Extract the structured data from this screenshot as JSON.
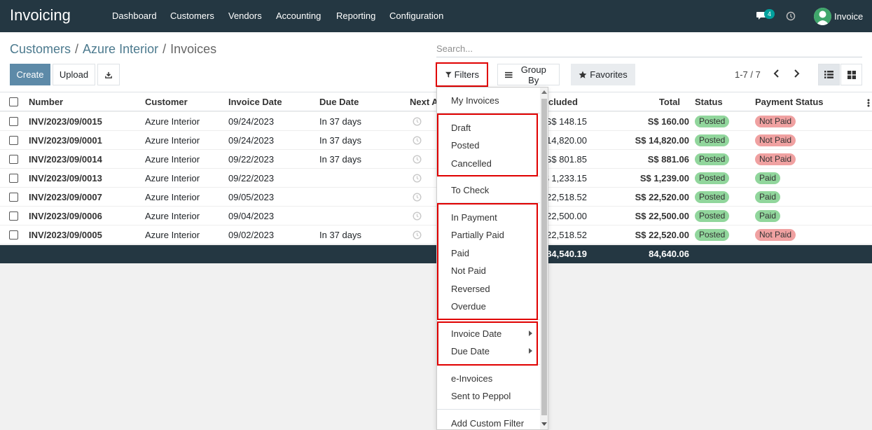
{
  "app": {
    "title": "Invoicing"
  },
  "menu": [
    "Dashboard",
    "Customers",
    "Vendors",
    "Accounting",
    "Reporting",
    "Configuration"
  ],
  "nav": {
    "chat_count": "4",
    "user": "Invoice"
  },
  "breadcrumb": {
    "part1": "Customers",
    "part2": "Azure Interior",
    "part3": "Invoices"
  },
  "search": {
    "placeholder": "Search..."
  },
  "buttons": {
    "create": "Create",
    "upload": "Upload",
    "filters": "Filters",
    "group_by": "Group By",
    "favorites": "Favorites"
  },
  "pager": {
    "text": "1-7 / 7"
  },
  "table": {
    "headers": {
      "number": "Number",
      "customer": "Customer",
      "invoice_date": "Invoice Date",
      "due_date": "Due Date",
      "next_activity": "Next A",
      "tax_excluded": "cluded",
      "total": "Total",
      "status": "Status",
      "payment_status": "Payment Status"
    },
    "rows": [
      {
        "number": "INV/2023/09/0015",
        "customer": "Azure Interior",
        "invoice_date": "09/24/2023",
        "due_date": "In 37 days",
        "tax_excluded": "S$ 148.15",
        "total": "S$ 160.00",
        "status": "Posted",
        "payment": "Not Paid"
      },
      {
        "number": "INV/2023/09/0001",
        "customer": "Azure Interior",
        "invoice_date": "09/24/2023",
        "due_date": "In 37 days",
        "tax_excluded": "14,820.00",
        "total": "S$ 14,820.00",
        "status": "Posted",
        "payment": "Not Paid"
      },
      {
        "number": "INV/2023/09/0014",
        "customer": "Azure Interior",
        "invoice_date": "09/22/2023",
        "due_date": "In 37 days",
        "tax_excluded": "S$ 801.85",
        "total": "S$ 881.06",
        "status": "Posted",
        "payment": "Not Paid"
      },
      {
        "number": "INV/2023/09/0013",
        "customer": "Azure Interior",
        "invoice_date": "09/22/2023",
        "due_date": "",
        "tax_excluded": "$ 1,233.15",
        "total": "S$ 1,239.00",
        "status": "Posted",
        "payment": "Paid"
      },
      {
        "number": "INV/2023/09/0007",
        "customer": "Azure Interior",
        "invoice_date": "09/05/2023",
        "due_date": "",
        "tax_excluded": "22,518.52",
        "total": "S$ 22,520.00",
        "status": "Posted",
        "payment": "Paid"
      },
      {
        "number": "INV/2023/09/0006",
        "customer": "Azure Interior",
        "invoice_date": "09/04/2023",
        "due_date": "",
        "tax_excluded": "22,500.00",
        "total": "S$ 22,500.00",
        "status": "Posted",
        "payment": "Paid"
      },
      {
        "number": "INV/2023/09/0005",
        "customer": "Azure Interior",
        "invoice_date": "09/02/2023",
        "due_date": "In 37 days",
        "tax_excluded": "22,518.52",
        "total": "S$ 22,520.00",
        "status": "Posted",
        "payment": "Not Paid"
      }
    ],
    "totals": {
      "tax_excluded": "84,540.19",
      "total": "84,640.06"
    }
  },
  "filters_menu": {
    "my_invoices": "My Invoices",
    "draft": "Draft",
    "posted": "Posted",
    "cancelled": "Cancelled",
    "to_check": "To Check",
    "in_payment": "In Payment",
    "partially_paid": "Partially Paid",
    "paid": "Paid",
    "not_paid": "Not Paid",
    "reversed": "Reversed",
    "overdue": "Overdue",
    "invoice_date": "Invoice Date",
    "due_date": "Due Date",
    "e_invoices": "e-Invoices",
    "sent_to_peppol": "Sent to Peppol",
    "add_custom_filter": "Add Custom Filter"
  },
  "colors": {
    "navbar": "#243742",
    "primary": "#5d8aa8",
    "posted": "#91d69c",
    "not_paid": "#f0a1a1",
    "highlight": "#e00000"
  }
}
